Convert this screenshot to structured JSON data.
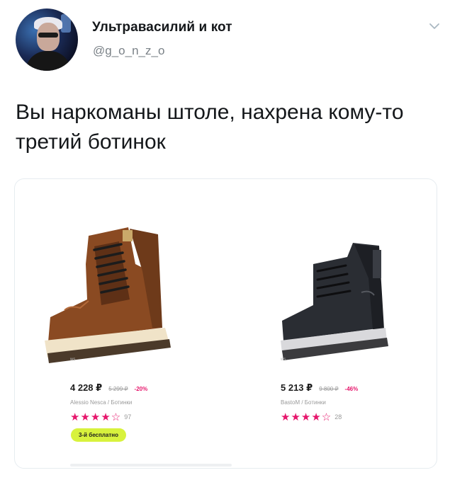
{
  "user": {
    "display_name": "Ультравасилий и кот",
    "handle": "@g_o_n_z_o"
  },
  "tweet": {
    "text": "Вы наркоманы штоле, нахрена кому-то третий ботинок"
  },
  "products": [
    {
      "brand_tag": "ws",
      "price": "4 228 ₽",
      "old_price": "5 299 ₽",
      "discount": "-20%",
      "brand_line": "Alessio Nesca / Ботинки",
      "stars": "★★★★☆",
      "rating": 4,
      "reviews": "97",
      "promo": "3-й бесплатно",
      "shoe_color": "#8a4a22"
    },
    {
      "brand_tag": "ws",
      "price": "5 213 ₽",
      "old_price": "9 800 ₽",
      "discount": "-46%",
      "brand_line": "BastoM / Ботинки",
      "stars": "★★★★☆",
      "rating": 4,
      "reviews": "28",
      "shoe_color": "#2a2d33"
    }
  ],
  "colors": {
    "accent_pink": "#e6156b",
    "promo_lime": "#d8f23d",
    "muted": "#9a9a9a"
  },
  "icons": {
    "caret": "chevron-down-icon"
  }
}
